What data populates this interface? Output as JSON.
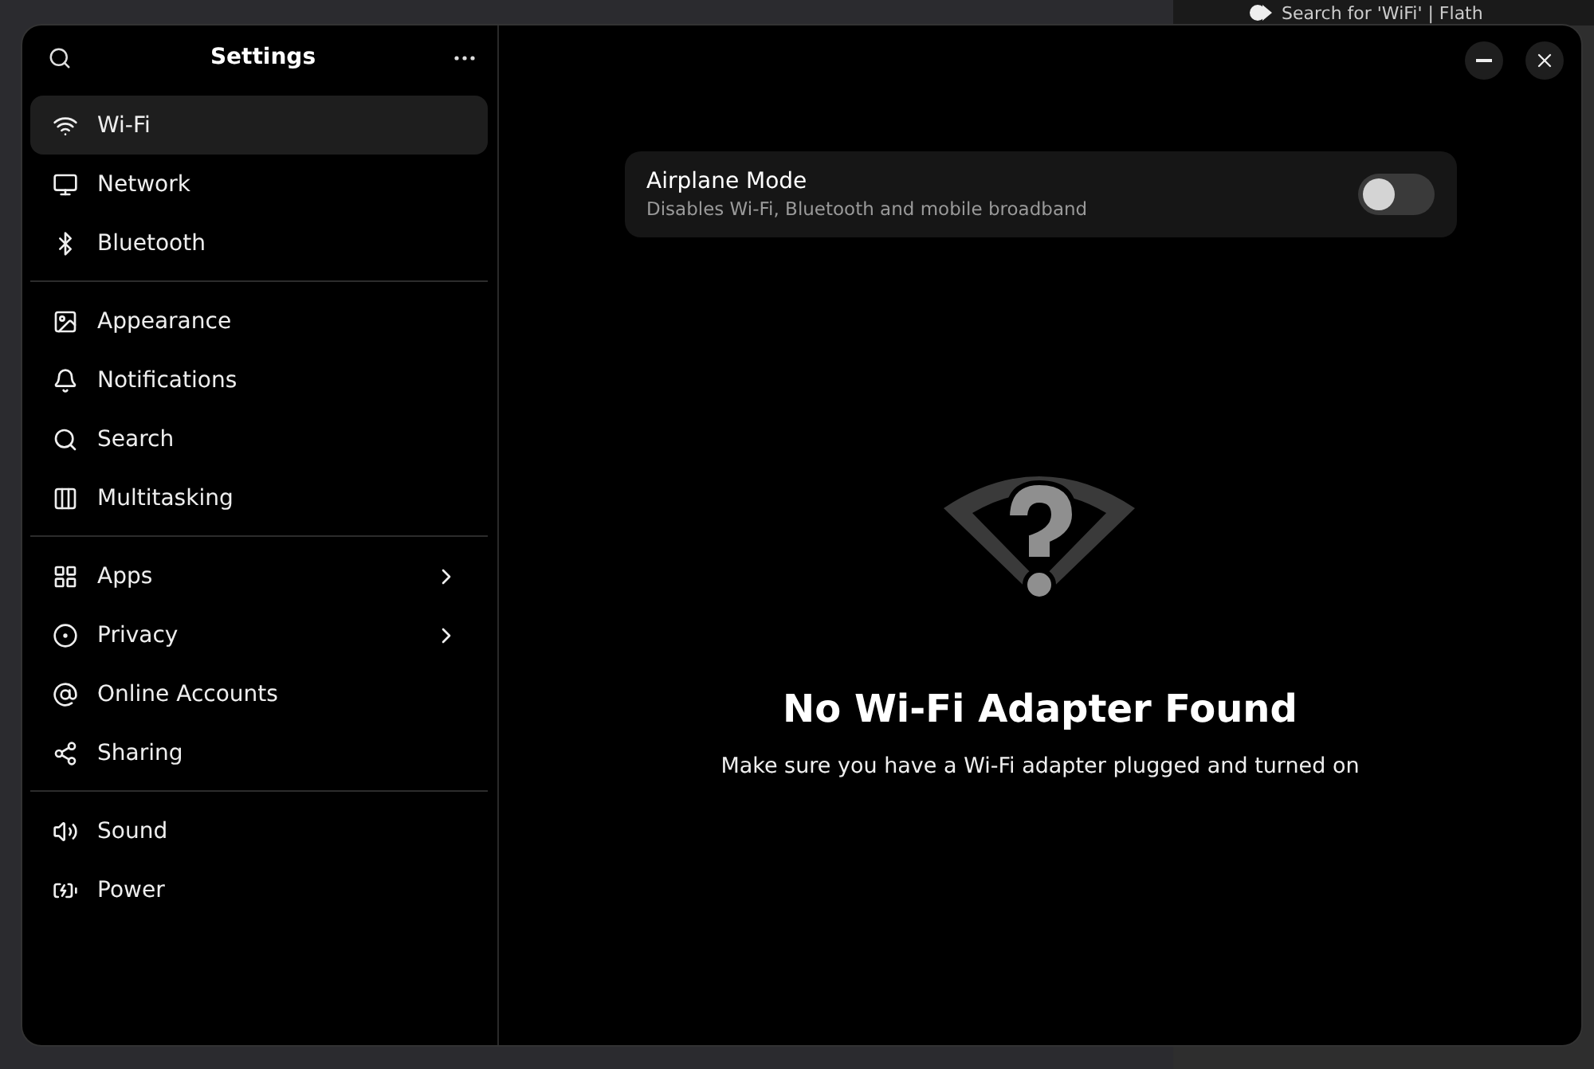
{
  "background_window": {
    "title": "Search for 'WiFi' | Flath"
  },
  "window": {
    "title": "Settings"
  },
  "sidebar": {
    "groups": [
      {
        "items": [
          {
            "label": "Wi-Fi",
            "selected": true,
            "has_submenu": false
          },
          {
            "label": "Network",
            "selected": false,
            "has_submenu": false
          },
          {
            "label": "Bluetooth",
            "selected": false,
            "has_submenu": false
          }
        ]
      },
      {
        "items": [
          {
            "label": "Appearance",
            "selected": false,
            "has_submenu": false
          },
          {
            "label": "Notifications",
            "selected": false,
            "has_submenu": false
          },
          {
            "label": "Search",
            "selected": false,
            "has_submenu": false
          },
          {
            "label": "Multitasking",
            "selected": false,
            "has_submenu": false
          }
        ]
      },
      {
        "items": [
          {
            "label": "Apps",
            "selected": false,
            "has_submenu": true
          },
          {
            "label": "Privacy",
            "selected": false,
            "has_submenu": true
          },
          {
            "label": "Online Accounts",
            "selected": false,
            "has_submenu": false
          },
          {
            "label": "Sharing",
            "selected": false,
            "has_submenu": false
          }
        ]
      },
      {
        "items": [
          {
            "label": "Sound",
            "selected": false,
            "has_submenu": false
          },
          {
            "label": "Power",
            "selected": false,
            "has_submenu": false
          }
        ]
      }
    ]
  },
  "airplane_mode": {
    "title": "Airplane Mode",
    "subtitle": "Disables Wi-Fi, Bluetooth and mobile broadband",
    "on": false
  },
  "empty_state": {
    "title": "No Wi-Fi Adapter Found",
    "message": "Make sure you have a Wi-Fi adapter plugged and turned on"
  }
}
